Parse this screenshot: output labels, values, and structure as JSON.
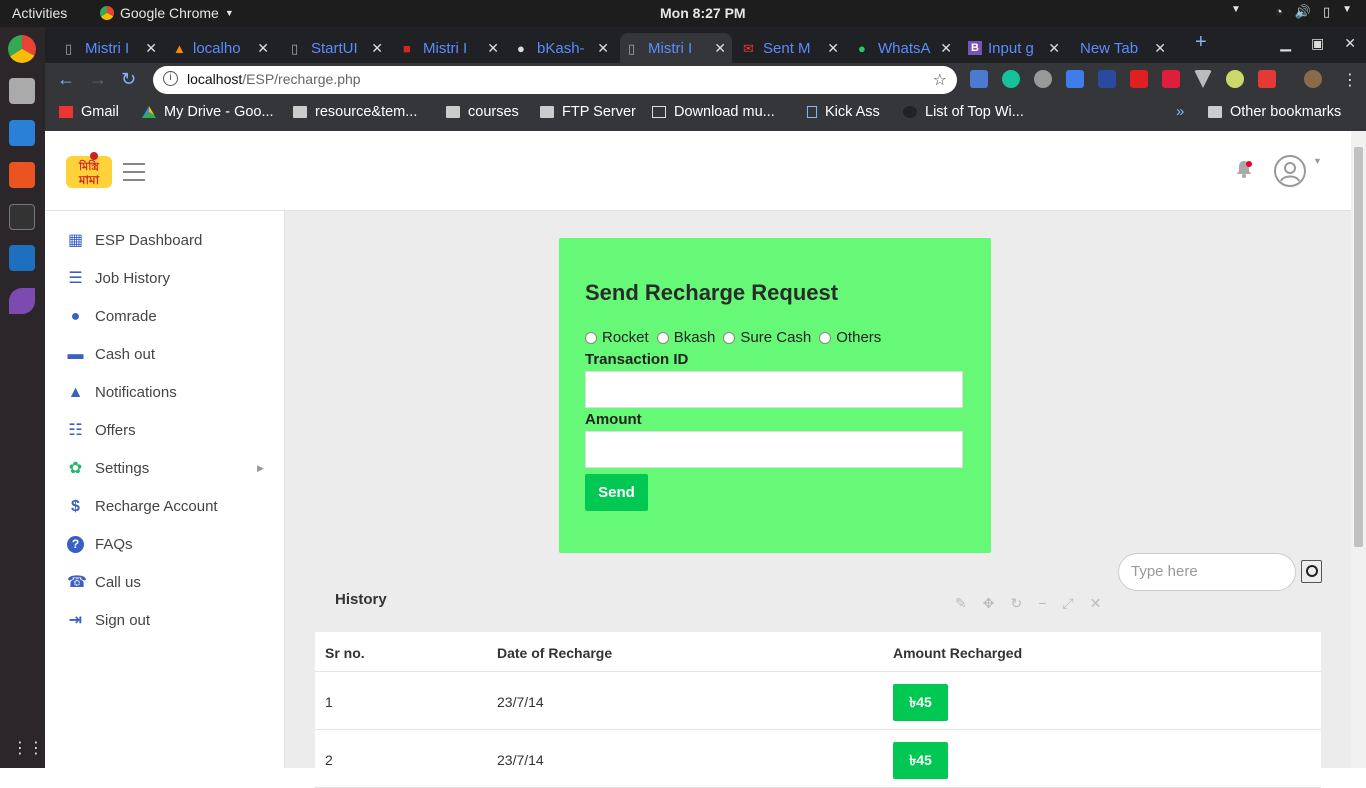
{
  "system": {
    "activities": "Activities",
    "app_name": "Google Chrome",
    "clock": "Mon  8:27 PM"
  },
  "browser": {
    "tabs": [
      {
        "label": "Mistri I"
      },
      {
        "label": "localho"
      },
      {
        "label": "StartUI"
      },
      {
        "label": "Mistri I"
      },
      {
        "label": "bKash-"
      },
      {
        "label": "Mistri I"
      },
      {
        "label": "Sent M"
      },
      {
        "label": "WhatsA"
      },
      {
        "label": "Input g"
      },
      {
        "label": "New Tab"
      }
    ],
    "new_tab": "+",
    "url_host": "localhost",
    "url_path": "/ESP/recharge.php",
    "bookmarks": [
      {
        "label": "Gmail"
      },
      {
        "label": "My Drive - Goo..."
      },
      {
        "label": "resource&tem..."
      },
      {
        "label": "courses"
      },
      {
        "label": "FTP Server"
      },
      {
        "label": "Download mu..."
      },
      {
        "label": "Kick Ass"
      },
      {
        "label": "List of Top Wi..."
      }
    ],
    "bookmarks_overflow": "»",
    "other_bookmarks": "Other bookmarks"
  },
  "sidebar": {
    "items": [
      {
        "label": "ESP Dashboard",
        "icon": "dashboard-icon"
      },
      {
        "label": "Job History",
        "icon": "server-icon"
      },
      {
        "label": "Comrade",
        "icon": "user-icon"
      },
      {
        "label": "Cash out",
        "icon": "credit-card-icon"
      },
      {
        "label": "Notifications",
        "icon": "bell-icon"
      },
      {
        "label": "Offers",
        "icon": "list-icon"
      },
      {
        "label": "Settings",
        "icon": "gear-icon"
      },
      {
        "label": "Recharge Account",
        "icon": "dollar-icon"
      },
      {
        "label": "FAQs",
        "icon": "question-icon"
      },
      {
        "label": "Call us",
        "icon": "phone-icon"
      },
      {
        "label": "Sign out",
        "icon": "sign-out-icon"
      }
    ]
  },
  "form": {
    "title": "Send Recharge Request",
    "options": [
      "Rocket",
      "Bkash",
      "Sure Cash",
      "Others"
    ],
    "transaction_label": "Transaction ID",
    "transaction_value": "",
    "amount_label": "Amount",
    "amount_value": "",
    "send_label": "Send"
  },
  "search": {
    "placeholder": "Type here"
  },
  "history": {
    "title": "History",
    "columns": [
      "Sr no.",
      "Date of Recharge",
      "Amount Recharged"
    ],
    "rows": [
      {
        "sr": "1",
        "date": "23/7/14",
        "amount": "৳45"
      },
      {
        "sr": "2",
        "date": "23/7/14",
        "amount": "৳45"
      }
    ]
  },
  "colors": {
    "card": "#66f977",
    "accent_green": "#00c853",
    "icon_blue": "#3a60c4",
    "content_bg": "#ececec"
  }
}
